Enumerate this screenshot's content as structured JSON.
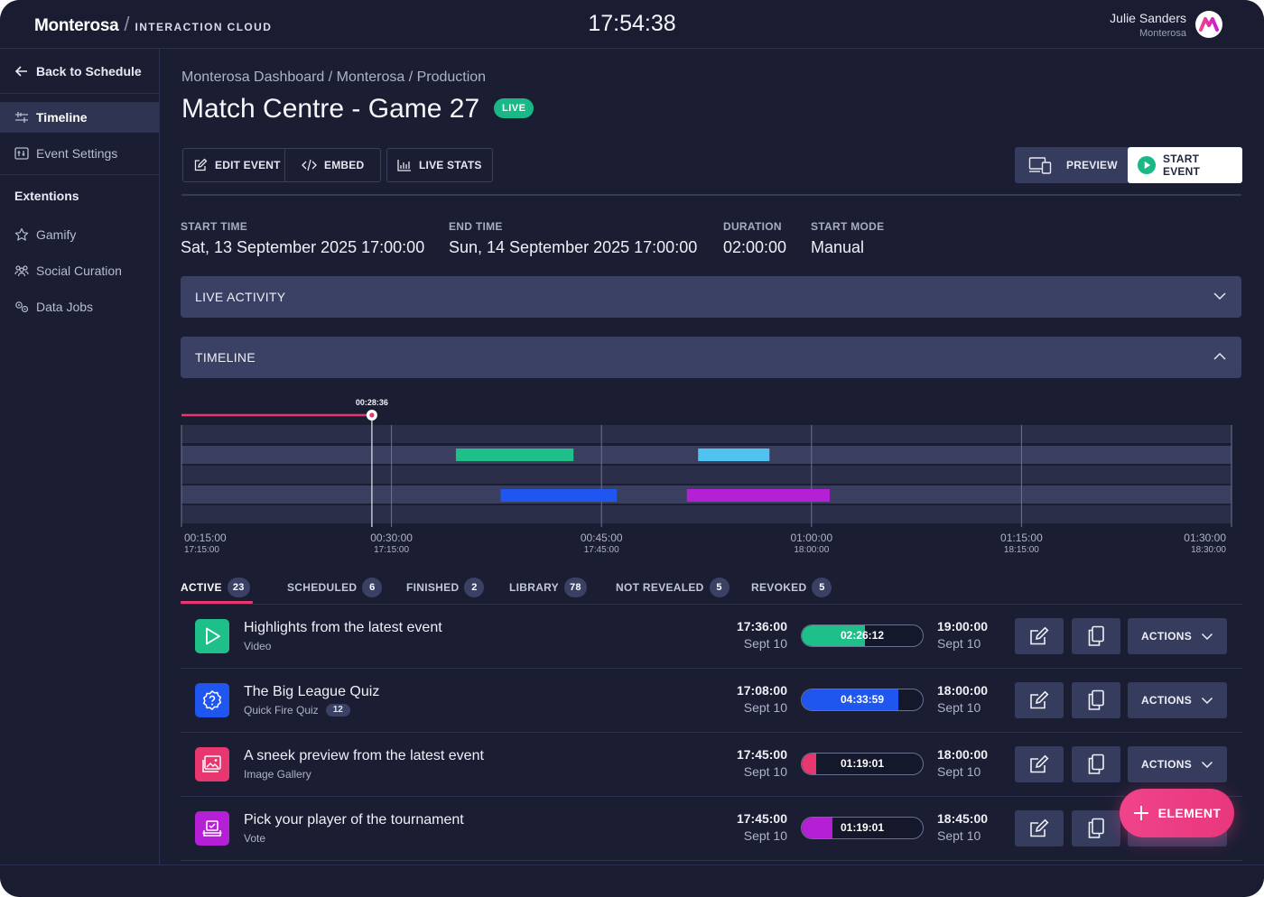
{
  "header": {
    "brand": "Monterosa",
    "brand_sub": "INTERACTION CLOUD",
    "clock": "17:54:38",
    "user_name": "Julie Sanders",
    "user_org": "Monterosa"
  },
  "sidebar": {
    "back_label": "Back to Schedule",
    "items": [
      {
        "label": "Timeline",
        "icon": "timeline-icon",
        "active": true
      },
      {
        "label": "Event Settings",
        "icon": "settings-icon",
        "active": false
      }
    ],
    "extensions_heading": "Extentions",
    "extensions": [
      {
        "label": "Gamify",
        "icon": "star-icon"
      },
      {
        "label": "Social Curation",
        "icon": "people-icon"
      },
      {
        "label": "Data Jobs",
        "icon": "data-jobs-icon"
      }
    ]
  },
  "main": {
    "breadcrumb": "Monterosa Dashboard / Monterosa / Production",
    "title": "Match Centre - Game 27",
    "live_badge": "LIVE",
    "toolbar": {
      "edit_label": "EDIT EVENT",
      "embed_label": "EMBED",
      "live_stats_label": "LIVE STATS",
      "preview_label": "PREVIEW",
      "start_label": "START EVENT"
    },
    "meta": {
      "start_label": "START TIME",
      "start_value": "Sat, 13 September 2025 17:00:00",
      "end_label": "END TIME",
      "end_value": "Sun, 14 September 2025 17:00:00",
      "duration_label": "DURATION",
      "duration_value": "02:00:00",
      "mode_label": "START MODE",
      "mode_value": "Manual"
    },
    "panels": {
      "live_activity": "LIVE ACTIVITY",
      "timeline": "TIMELINE"
    },
    "timeline": {
      "playhead_label": "00:28:36",
      "playhead_offset_min": 28.6,
      "range_min": [
        15,
        90
      ],
      "ticks": [
        {
          "offset_min": 15,
          "label": "00:15:00",
          "clock": "17:15:00"
        },
        {
          "offset_min": 30,
          "label": "00:30:00",
          "clock": "17:15:00"
        },
        {
          "offset_min": 45,
          "label": "00:45:00",
          "clock": "17:45:00"
        },
        {
          "offset_min": 60,
          "label": "01:00:00",
          "clock": "18:00:00"
        },
        {
          "offset_min": 75,
          "label": "01:15:00",
          "clock": "18:15:00"
        },
        {
          "offset_min": 90,
          "label": "01:30:00",
          "clock": "18:30:00"
        }
      ],
      "bars": [
        {
          "lane": 0,
          "start_min": 34.6,
          "end_min": 43.0,
          "color": "#1fbf8a"
        },
        {
          "lane": 0,
          "start_min": 51.9,
          "end_min": 57.0,
          "color": "#4fc2f0"
        },
        {
          "lane": 1,
          "start_min": 37.8,
          "end_min": 46.1,
          "color": "#1f56f0"
        },
        {
          "lane": 1,
          "start_min": 51.1,
          "end_min": 61.3,
          "color": "#b51fd6"
        }
      ]
    },
    "tabs": [
      {
        "label": "ACTIVE",
        "count": "23"
      },
      {
        "label": "SCHEDULED",
        "count": "6"
      },
      {
        "label": "FINISHED",
        "count": "2"
      },
      {
        "label": "LIBRARY",
        "count": "78"
      },
      {
        "label": "NOT REVEALED",
        "count": "5"
      },
      {
        "label": "REVOKED",
        "count": "5"
      }
    ],
    "rows": [
      {
        "title": "Highlights from the latest event",
        "subtitle": "Video",
        "icon": "play-icon",
        "color": "#1fbf8a",
        "start_time": "17:36:00",
        "start_date": "Sept 10",
        "elapsed": "02:26:12",
        "progress": 0.52,
        "end_time": "19:00:00",
        "end_date": "Sept 10",
        "actions_label": "ACTIONS"
      },
      {
        "title": "The Big League Quiz",
        "subtitle": "Quick Fire Quiz",
        "sub_count": "12",
        "icon": "quiz-icon",
        "color": "#1f56f0",
        "start_time": "17:08:00",
        "start_date": "Sept 10",
        "elapsed": "04:33:59",
        "progress": 0.8,
        "end_time": "18:00:00",
        "end_date": "Sept 10",
        "actions_label": "ACTIONS"
      },
      {
        "title": "A sneek preview from the latest event",
        "subtitle": "Image Gallery",
        "icon": "image-gallery-icon",
        "color": "#e8376f",
        "start_time": "17:45:00",
        "start_date": "Sept 10",
        "elapsed": "01:19:01",
        "progress": 0.12,
        "end_time": "18:00:00",
        "end_date": "Sept 10",
        "actions_label": "ACTIONS"
      },
      {
        "title": "Pick your player of the tournament",
        "subtitle": "Vote",
        "icon": "vote-icon",
        "color": "#b51fd6",
        "start_time": "17:45:00",
        "start_date": "Sept 10",
        "elapsed": "01:19:01",
        "progress": 0.25,
        "end_time": "18:45:00",
        "end_date": "Sept 10",
        "actions_label": ""
      }
    ],
    "fab_label": "ELEMENT"
  }
}
